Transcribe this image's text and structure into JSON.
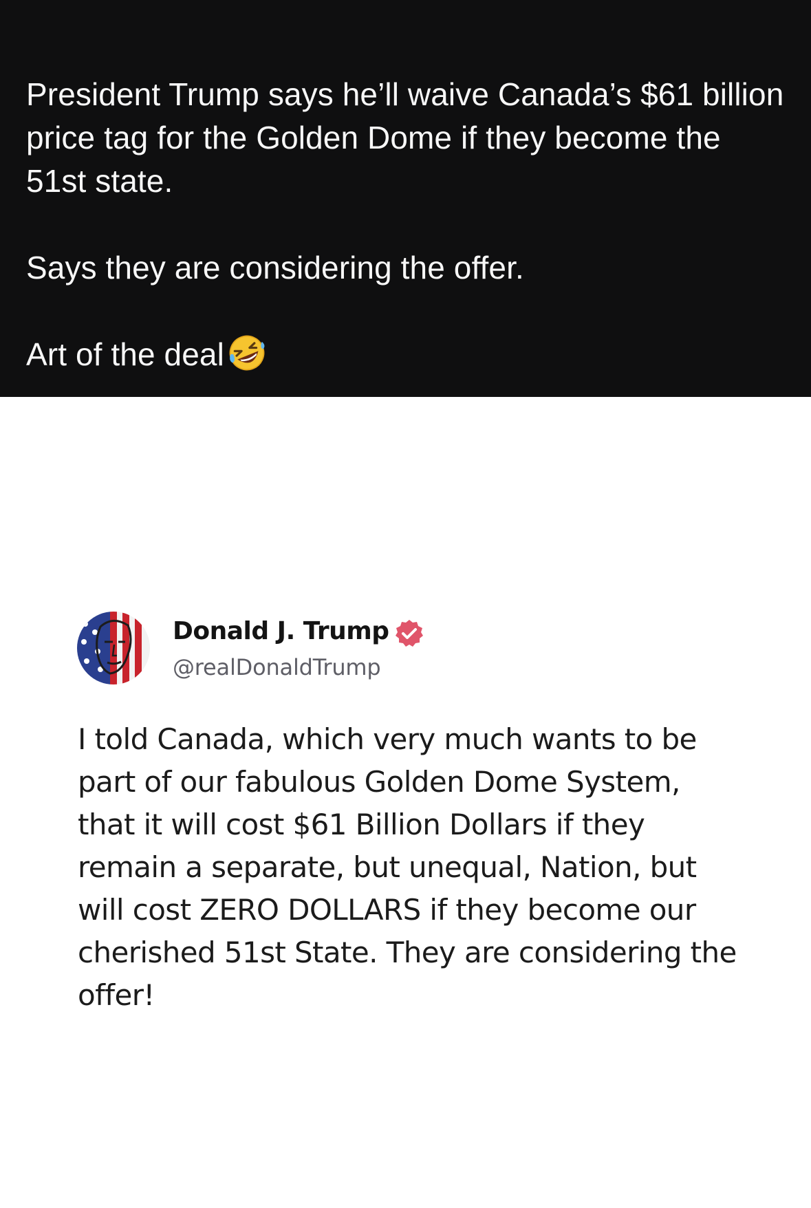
{
  "caption": {
    "paragraph_1": "President Trump says he’ll waive Canada’s $61 billion price tag for the Golden Dome if they become the 51st state.",
    "paragraph_2": "Says they are considering the offer.",
    "paragraph_3": "Art of the deal",
    "emoji": "rolling-on-floor-laughing-emoji"
  },
  "post": {
    "author_name": "Donald J. Trump",
    "author_handle": "@realDonaldTrump",
    "verified_icon": "verified-badge-icon",
    "avatar": "flag-portrait-avatar",
    "body_text": "I told Canada, which very much wants to be part of our fabulous Golden Dome System, that it will cost $61 Billion Dollars if they remain a separate, but unequal, Nation, but will cost ZERO DOLLARS if they become our cherished 51st State. They are considering the offer!"
  },
  "colors": {
    "caption_background": "#0f0f10",
    "caption_text": "#f7f7f7",
    "post_background": "#ffffff",
    "verified_badge": "#e0556a",
    "handle_text": "#5e5e66"
  }
}
